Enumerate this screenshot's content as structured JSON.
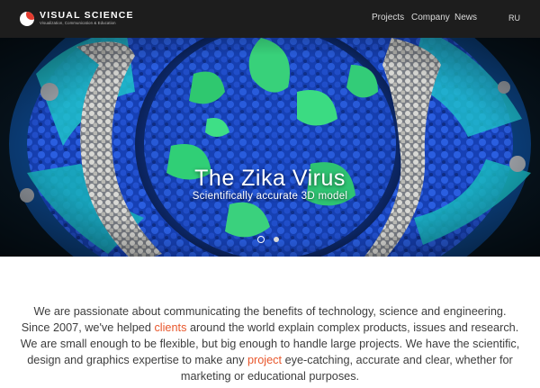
{
  "brand": {
    "name": "VISUAL SCIENCE",
    "tagline": "Visualization, Communication & Education"
  },
  "nav": {
    "projects": "Projects",
    "company": "Company",
    "news": "News",
    "language": "RU"
  },
  "hero": {
    "title": "The Zika Virus",
    "subtitle": "Scientifically accurate 3D model",
    "slides_count": 2,
    "active_slide": 1
  },
  "intro": {
    "part1": "We are passionate about communicating the benefits of technology, science and engineering. Since 2007, we've helped ",
    "link1": "clients",
    "part2": " around the world explain complex products, issues and research. We are small enough to be flexible, but big enough to handle large projects. We have the scientific, design and graphics expertise to make any ",
    "link2": "project",
    "part3": " eye-catching, accurate and clear, whether for marketing or educational purposes."
  },
  "colors": {
    "navbar": "#1d1d1d",
    "accent_link": "#e8572c",
    "logo_red": "#e23b2e"
  }
}
